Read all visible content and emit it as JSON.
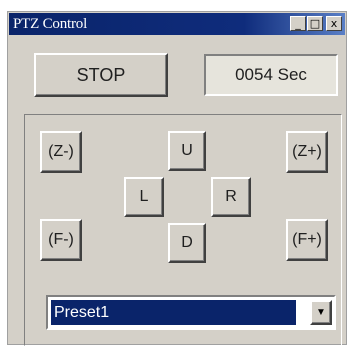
{
  "window": {
    "title": "PTZ Control",
    "controls": {
      "minimize": "_",
      "maximize": "□",
      "close": "x"
    }
  },
  "top": {
    "stop_label": "STOP",
    "timer_text": "0054 Sec"
  },
  "ptz": {
    "zoom_out": "(Z-)",
    "zoom_in": "(Z+)",
    "focus_near": "(F-)",
    "focus_far": "(F+)",
    "up": "U",
    "down": "D",
    "left": "L",
    "right": "R"
  },
  "preset": {
    "selected": "Preset1",
    "arrow": "▼"
  },
  "colors": {
    "titlebar": "#0a246a",
    "window_face": "#d4d0c8",
    "selection": "#0a246a"
  }
}
